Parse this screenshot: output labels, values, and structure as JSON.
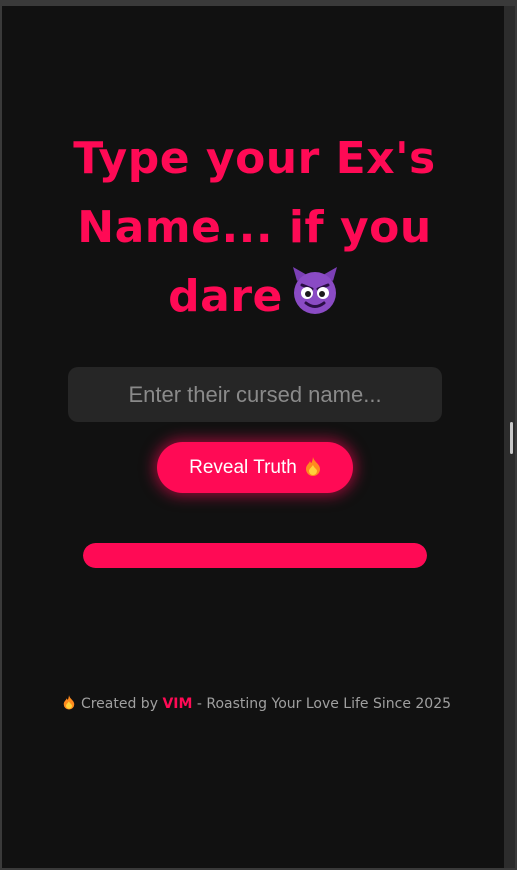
{
  "hero": {
    "title": "Type your Ex's Name... if you dare",
    "title_icon": "smiling-devil-icon"
  },
  "form": {
    "input_value": "",
    "input_placeholder": "Enter their cursed name...",
    "submit_label": "Reveal Truth",
    "submit_icon": "fire-icon"
  },
  "progress": {
    "fill_fraction": 1.0
  },
  "footer": {
    "icon": "fire-icon",
    "prefix": "Created by",
    "author": "VIM",
    "suffix": "- Roasting Your Love Life Since 2025"
  },
  "colors": {
    "background": "#111111",
    "accent": "#ff0a55",
    "input_bg": "#262626",
    "footer_text": "#a0a0a0"
  }
}
